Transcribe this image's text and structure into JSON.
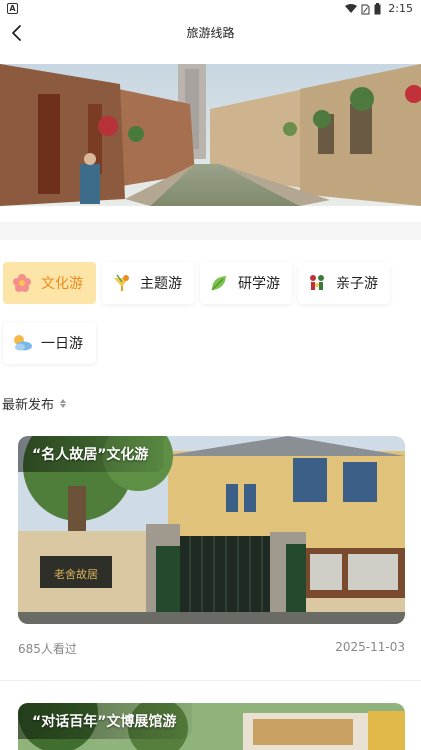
{
  "status_bar": {
    "time": "2:15",
    "left_icon": "A"
  },
  "nav": {
    "title": "旅游线路"
  },
  "categories": [
    {
      "label": "文化游",
      "icon": "flower-icon",
      "active": true
    },
    {
      "label": "主题游",
      "icon": "cocktail-icon",
      "active": false
    },
    {
      "label": "研学游",
      "icon": "leaf-icon",
      "active": false
    },
    {
      "label": "亲子游",
      "icon": "family-icon",
      "active": false
    },
    {
      "label": "一日游",
      "icon": "sun-cloud-icon",
      "active": false
    }
  ],
  "sort": {
    "label": "最新发布"
  },
  "routes": [
    {
      "title": "“名人故居”文化游",
      "views": "685人看过",
      "date": "2025-11-03",
      "sign_text": "老舍故居"
    },
    {
      "title": "“对话百年”文博展馆游"
    }
  ],
  "colors": {
    "active_chip_bg": "#fce5a6",
    "active_chip_text": "#f08a1c"
  }
}
